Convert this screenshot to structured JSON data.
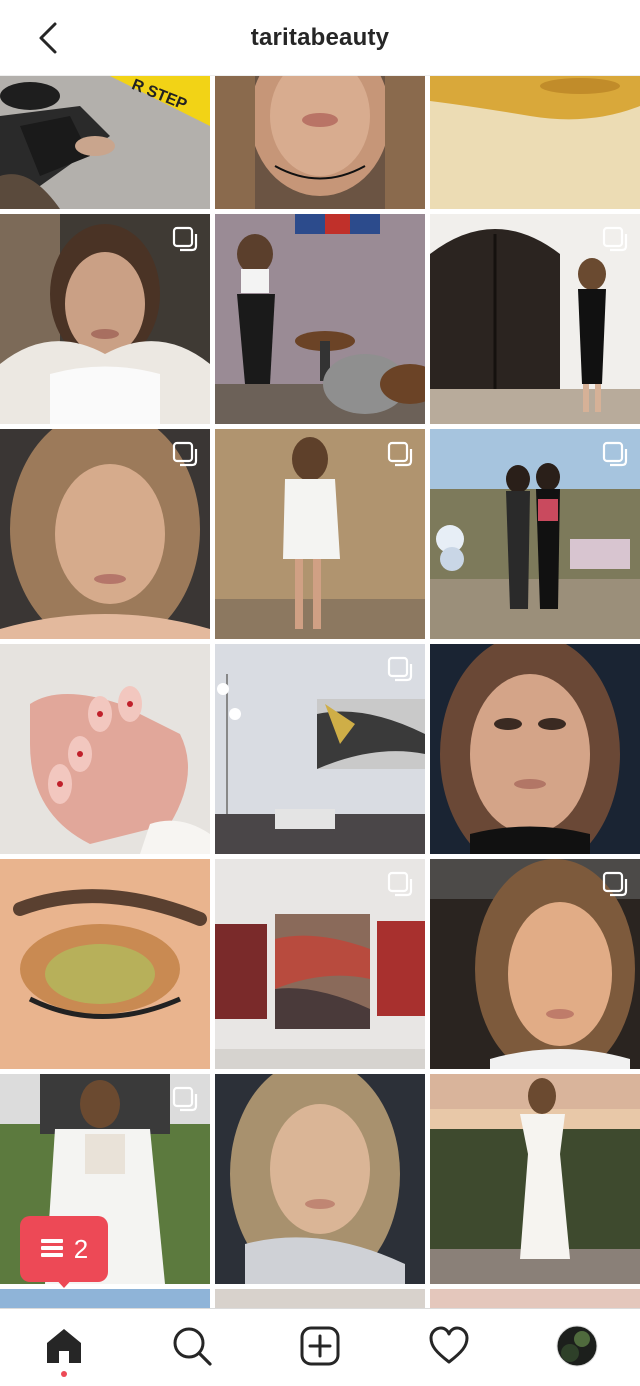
{
  "header": {
    "title": "taritabeauty"
  },
  "photo_text": {
    "caution_tape": "R STEP"
  },
  "activity_popup": {
    "count": "2",
    "icon": "comment-bubble-icon"
  },
  "tabbar": {
    "items": [
      {
        "name": "home",
        "icon": "home-icon",
        "active": true
      },
      {
        "name": "search",
        "icon": "search-icon"
      },
      {
        "name": "new-post",
        "icon": "plus-square-icon"
      },
      {
        "name": "activity",
        "icon": "heart-icon"
      },
      {
        "name": "profile",
        "icon": "profile-avatar-icon"
      }
    ]
  },
  "colors": {
    "accent": "#ed4956",
    "text": "#262626",
    "divider": "#dbdbdb"
  }
}
